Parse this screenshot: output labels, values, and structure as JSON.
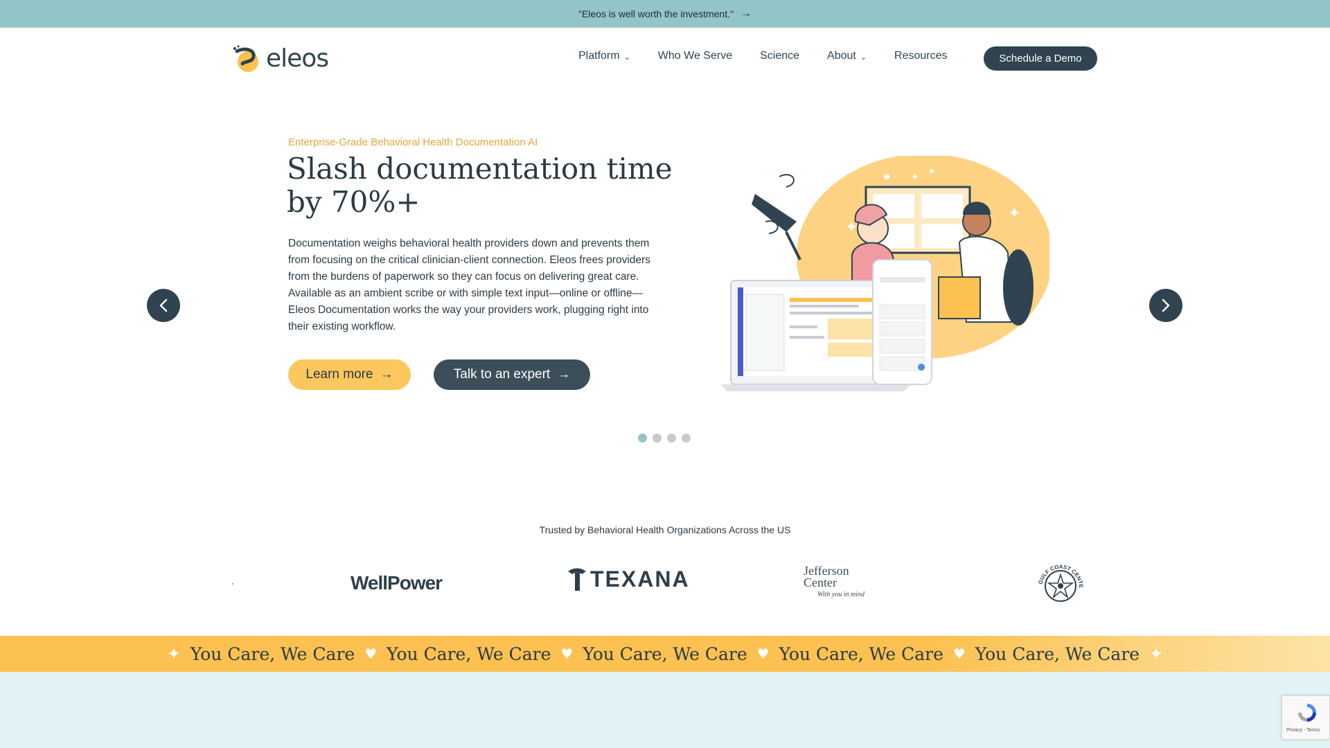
{
  "announcement": {
    "text": "\"Eleos is well worth the investment.\"",
    "arrow_icon": "arrow-right-icon"
  },
  "header": {
    "logo_text": "eleos",
    "nav": [
      {
        "label": "Platform",
        "has_dropdown": true
      },
      {
        "label": "Who We Serve",
        "has_dropdown": false
      },
      {
        "label": "Science",
        "has_dropdown": false
      },
      {
        "label": "About",
        "has_dropdown": true
      },
      {
        "label": "Resources",
        "has_dropdown": false
      }
    ],
    "cta_label": "Schedule a Demo"
  },
  "hero": {
    "eyebrow": "Enterprise-Grade Behavioral Health Documentation AI",
    "headline": "Slash documentation time by 70%+",
    "body": "Documentation weighs behavioral health providers down and prevents them from focusing on the critical clinician-client connection. Eleos frees providers from the burdens of paperwork so they can focus on delivering great care. Available as an ambient scribe or with simple text input—online or offline—Eleos Documentation works the way your providers work, plugging right into their existing workflow.",
    "primary_button": "Learn more",
    "secondary_button": "Talk to an expert",
    "carousel": {
      "slide_count": 4,
      "active_index": 0
    }
  },
  "trusted": {
    "heading": "Trusted by Behavioral Health Organizations Across the US",
    "logos": [
      {
        "name": "WellPower",
        "text": "WellPower"
      },
      {
        "name": "Texana",
        "text": "TEXANA"
      },
      {
        "name": "Jefferson Center",
        "line1": "Jefferson",
        "line2": "Center",
        "tagline": "With you in mind"
      },
      {
        "name": "Gulf Coast Center",
        "text": "GULF COAST CENTER"
      }
    ]
  },
  "marquee": {
    "phrases": [
      "You Care, We Care",
      "You Care, We Care",
      "You Care, We Care",
      "You Care, We Care",
      "You Care, We Care"
    ]
  },
  "recaptcha": {
    "text": "Privacy - Terms"
  },
  "colors": {
    "announce_bg": "#93c4c8",
    "brand_dark": "#2f4450",
    "accent_yellow": "#fcc75c",
    "eyebrow_gold": "#e3a73a",
    "bottom_band": "#e2f3f5"
  }
}
